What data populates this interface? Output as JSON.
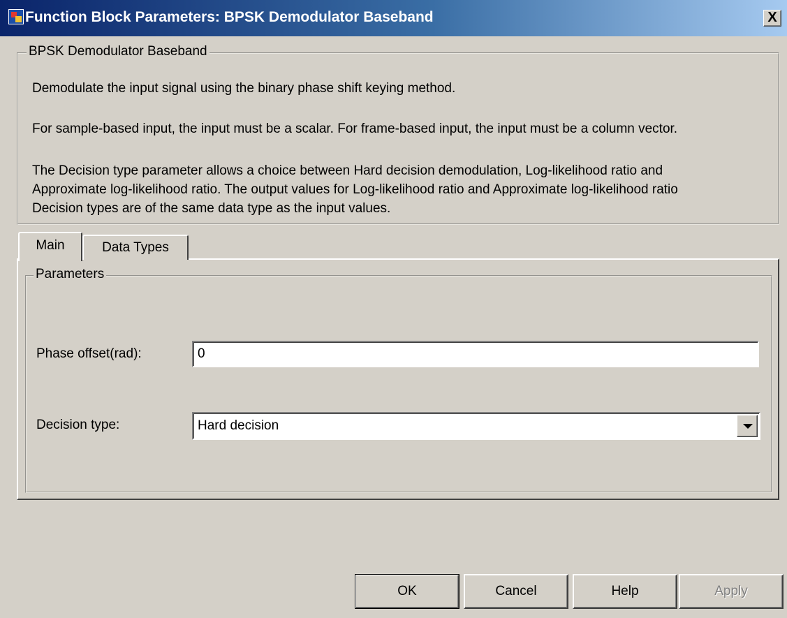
{
  "window": {
    "title": "Function Block Parameters: BPSK Demodulator Baseband",
    "close_glyph": "X",
    "app_icon": "simulink-block-icon"
  },
  "description": {
    "group_title": "BPSK Demodulator Baseband",
    "paragraphs": [
      "Demodulate the input signal using the binary phase shift keying method.",
      "For sample-based input, the input must be a scalar. For frame-based input, the input must be a column vector.",
      "The Decision type parameter allows a choice between Hard decision demodulation, Log-likelihood ratio and",
      "Approximate log-likelihood ratio.  The output values for Log-likelihood ratio and Approximate log-likelihood ratio",
      "Decision types are of the same data type as the input values."
    ]
  },
  "tabs": [
    {
      "label": "Main",
      "selected": true
    },
    {
      "label": "Data Types",
      "selected": false
    }
  ],
  "parameters": {
    "group_title": "Parameters",
    "phase_offset": {
      "label": "Phase offset(rad):",
      "value": "0"
    },
    "decision_type": {
      "label": "Decision type:",
      "value": "Hard decision"
    }
  },
  "buttons": {
    "ok": "OK",
    "cancel": "Cancel",
    "help": "Help",
    "apply": "Apply"
  },
  "colors": {
    "face": "#d4d0c8",
    "title_start": "#0a246a",
    "title_end": "#a6caf0"
  }
}
